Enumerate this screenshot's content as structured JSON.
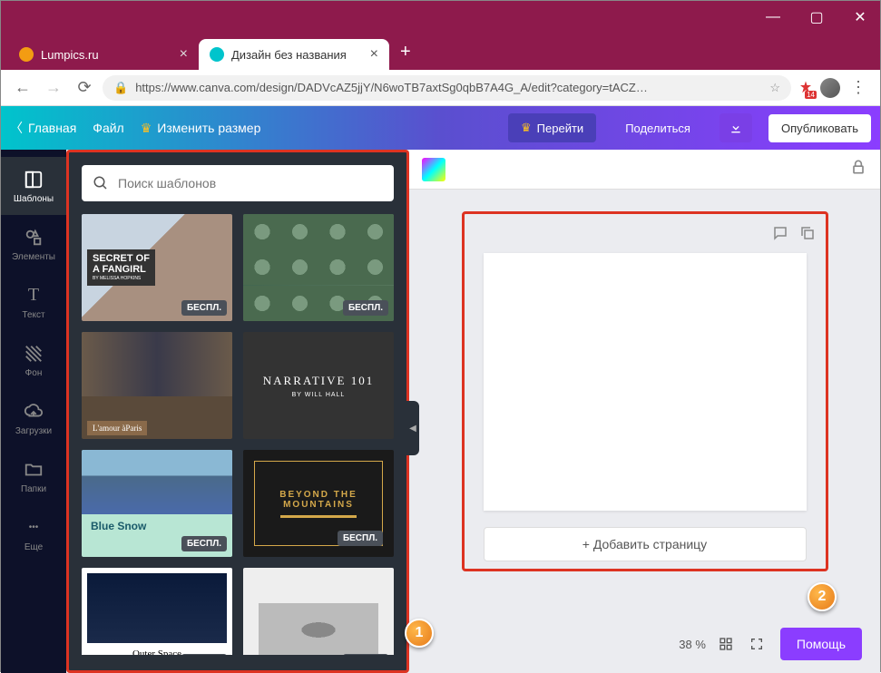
{
  "browser": {
    "tabs": [
      {
        "label": "Lumpics.ru"
      },
      {
        "label": "Дизайн без названия"
      }
    ],
    "url": "https://www.canva.com/design/DADVcAZ5jjY/N6woTB7axtSg0qbB7A4G_A/edit?category=tACZ…",
    "ext_badge": "14"
  },
  "toolbar": {
    "home": "Главная",
    "file": "Файл",
    "resize": "Изменить размер",
    "go": "Перейти",
    "share": "Поделиться",
    "publish": "Опубликовать"
  },
  "sidenav": {
    "templates": "Шаблоны",
    "elements": "Элементы",
    "text": "Текст",
    "background": "Фон",
    "uploads": "Загрузки",
    "folders": "Папки",
    "more": "Еще"
  },
  "panel": {
    "search_placeholder": "Поиск шаблонов",
    "free_badge": "БЕСПЛ.",
    "tpl": {
      "t1a": "SECRET OF",
      "t1b": "A FANGIRL",
      "t1c": "BY MELISSA HOPKINS",
      "t3": "L'amour àParis",
      "t4a": "NARRATIVE 101",
      "t4b": "BY WILL HALL",
      "t5": "Blue Snow",
      "t6a": "BEYOND THE",
      "t6b": "MOUNTAINS",
      "t7": "Outer Space"
    }
  },
  "canvas": {
    "add_page": "+ Добавить страницу",
    "zoom": "38 %",
    "help": "Помощь"
  },
  "markers": {
    "m1": "1",
    "m2": "2"
  }
}
